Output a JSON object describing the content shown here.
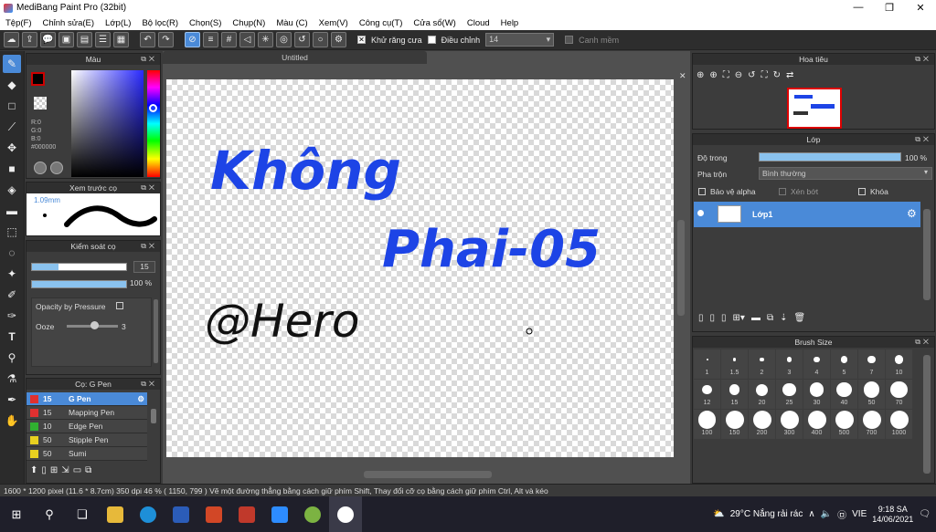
{
  "window": {
    "title": "MediBang Paint Pro (32bit)",
    "minimize": "—",
    "restore": "❐",
    "close": "✕"
  },
  "menu": [
    "Tệp(F)",
    "Chỉnh sửa(E)",
    "Lớp(L)",
    "Bộ lọc(R)",
    "Chọn(S)",
    "Chụp(N)",
    "Màu (C)",
    "Xem(V)",
    "Công cụ(T)",
    "Cửa sổ(W)",
    "Cloud",
    "Help"
  ],
  "toolbar": {
    "antialias_label": "Khử răng cưa",
    "adjust_label": "Điều chỉnh",
    "adjust_value": "14",
    "snap_label": "Canh mềm"
  },
  "color_panel": {
    "title": "Màu",
    "r": "R:0",
    "g": "G:0",
    "b": "B:0",
    "hex": "#000000",
    "colors": {
      "selection": "#4a8ad8",
      "hue_current": "#1a3cff"
    }
  },
  "brush_preview": {
    "title": "Xem trước cọ",
    "size": "1.09mm"
  },
  "brush_control": {
    "title": "Kiểm soát cọ",
    "size_value": "15",
    "size_fraction": 0.28,
    "opacity_value": "100 %",
    "opacity_fraction": 1.0,
    "opacity_by_pressure": "Opacity by Pressure",
    "ooze_label": "Ooze",
    "ooze_value": "3"
  },
  "brush_list": {
    "title": "Cọ: G Pen",
    "items": [
      {
        "size": "15",
        "name": "G Pen",
        "color": "#e03030",
        "selected": true
      },
      {
        "size": "15",
        "name": "Mapping Pen",
        "color": "#e03030",
        "selected": false
      },
      {
        "size": "10",
        "name": "Edge Pen",
        "color": "#30b030",
        "selected": false
      },
      {
        "size": "50",
        "name": "Stipple Pen",
        "color": "#e8d020",
        "selected": false
      },
      {
        "size": "50",
        "name": "Sumi",
        "color": "#e8d020",
        "selected": false
      }
    ]
  },
  "document": {
    "tab_title": "Untitled",
    "drawing": {
      "line1": "Không",
      "line2": "Phai-05",
      "line3": "@Hero"
    }
  },
  "navigator": {
    "title": "Hoa tiêu"
  },
  "layers": {
    "title": "Lớp",
    "opacity_label": "Độ trong",
    "opacity_value": "100 %",
    "blend_label": "Pha trộn",
    "blend_value": "Bình thường",
    "protect_alpha": "Bảo vệ alpha",
    "clipping": "Xén bớt",
    "lock": "Khóa",
    "items": [
      {
        "name": "Lớp1"
      }
    ]
  },
  "brush_size": {
    "title": "Brush Size",
    "sizes": [
      "1",
      "1.5",
      "2",
      "3",
      "4",
      "5",
      "7",
      "10",
      "12",
      "15",
      "20",
      "25",
      "30",
      "40",
      "50",
      "70",
      "100",
      "150",
      "200",
      "300",
      "400",
      "500",
      "700",
      "1000"
    ]
  },
  "status_bar": {
    "text": "1600 * 1200 pixel   (11.6 * 8.7cm)   350 dpi   46 %   ( 1150, 799 )   Vẽ một đường thẳng bằng cách giữ phím Shift, Thay đổi cỡ cọ bằng cách giữ phím Ctrl, Alt và kéo"
  },
  "taskbar": {
    "weather": "29°C  Nắng rải rác",
    "lang": "VIE",
    "time": "9:18 SA",
    "date": "14/06/2021"
  }
}
